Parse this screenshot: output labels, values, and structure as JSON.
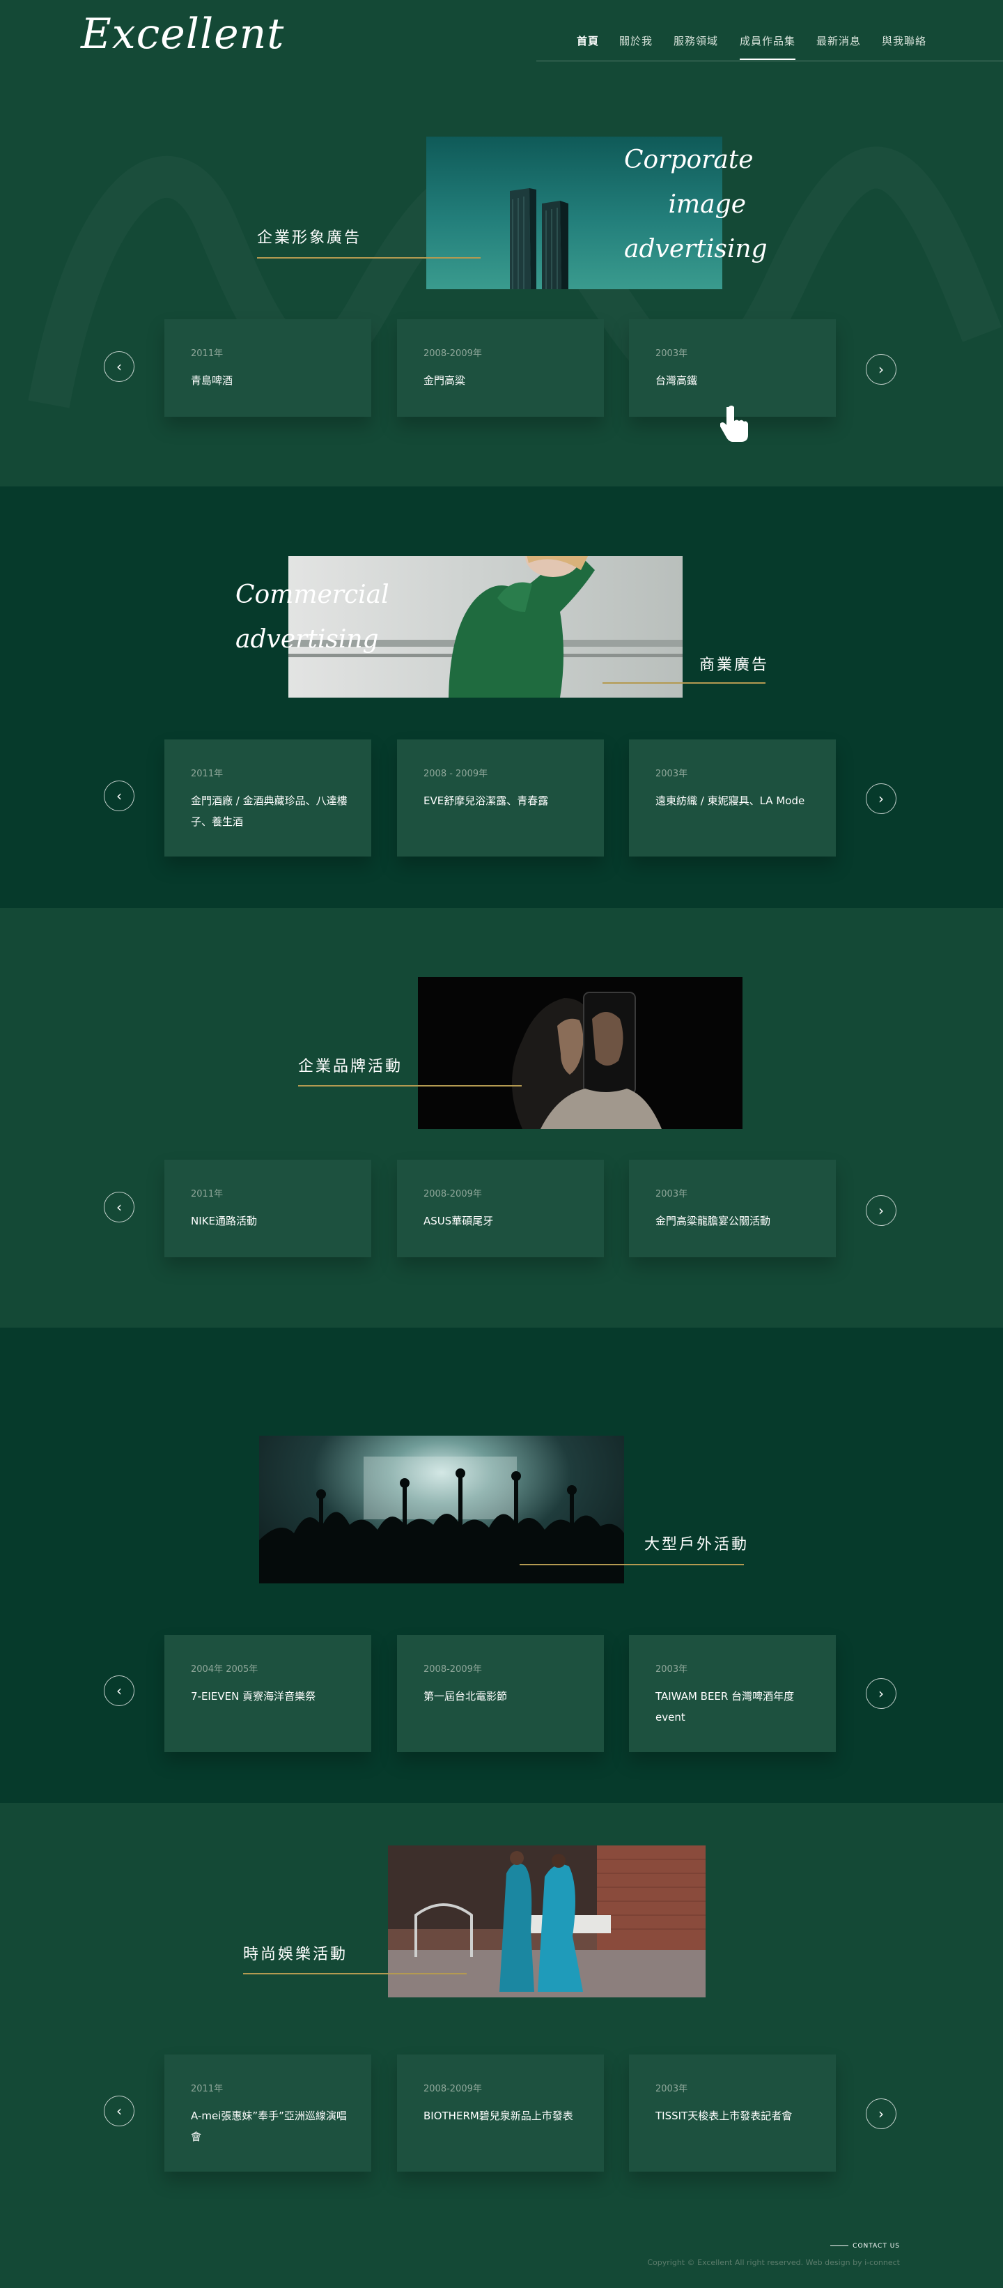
{
  "header": {
    "logo": "Excellent",
    "nav": [
      {
        "label": "首頁"
      },
      {
        "label": "關於我"
      },
      {
        "label": "服務領域"
      },
      {
        "label": "成員作品集"
      },
      {
        "label": "最新消息"
      },
      {
        "label": "與我聯絡"
      }
    ]
  },
  "sections": [
    {
      "title": "企業形象廣告",
      "script_lines": [
        "Corporate",
        "image",
        "advertising"
      ],
      "cards": [
        {
          "year": "2011年",
          "title": "青島啤酒"
        },
        {
          "year": "2008-2009年",
          "title": "金門高粱"
        },
        {
          "year": "2003年",
          "title": "台灣高鐵"
        }
      ]
    },
    {
      "title": "商業廣告",
      "script_lines": [
        "Commercial",
        "advertising"
      ],
      "cards": [
        {
          "year": "2011年",
          "title": "金門酒廠 / 金酒典藏珍品、八達樓子、養生酒"
        },
        {
          "year": "2008 - 2009年",
          "title": "EVE舒摩兒浴潔露、青春露"
        },
        {
          "year": "2003年",
          "title": "遠東紡織 / 東妮寢具、LA Mode"
        }
      ]
    },
    {
      "title": "企業品牌活動",
      "cards": [
        {
          "year": "2011年",
          "title": "NIKE通路活動"
        },
        {
          "year": "2008-2009年",
          "title": "ASUS華碩尾牙"
        },
        {
          "year": "2003年",
          "title": "金門高粱龍膽宴公關活動"
        }
      ]
    },
    {
      "title": "大型戶外活動",
      "cards": [
        {
          "year": "2004年 2005年",
          "title": "7-EIEVEN 貢寮海洋音樂祭"
        },
        {
          "year": "2008-2009年",
          "title": "第一屆台北電影節"
        },
        {
          "year": "2003年",
          "title": "TAIWAM BEER 台灣啤酒年度event"
        }
      ]
    },
    {
      "title": "時尚娛樂活動",
      "cards": [
        {
          "year": "2011年",
          "title": "A-mei張惠妹”奉手”亞洲巡線演唱會"
        },
        {
          "year": "2008-2009年",
          "title": "BIOTHERM碧兒泉新品上市發表"
        },
        {
          "year": "2003年",
          "title": "TISSIT天梭表上市發表記者會"
        }
      ]
    }
  ],
  "footer": {
    "contact": "CONTACT US",
    "copyright": "Copyright © Excellent All right reserved. Web design by i-connect"
  },
  "icons": {
    "prev": "chevron-left-icon",
    "next": "chevron-right-icon"
  }
}
